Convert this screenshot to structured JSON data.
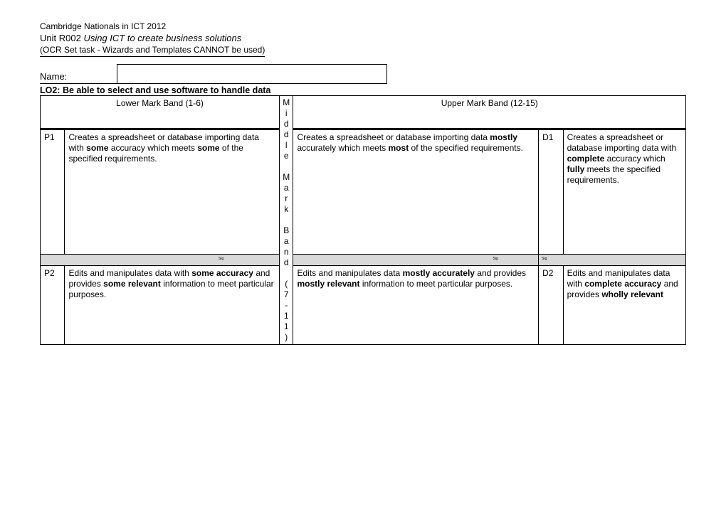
{
  "header": {
    "course": "Cambridge Nationals in ICT 2012",
    "unit": "Unit R002",
    "unit_title": "Using ICT to create business solutions",
    "note": "(OCR Set task - Wizards and Templates CANNOT be used)",
    "name_label": "Name:"
  },
  "lo": "LO2: Be able to select and use software to handle data",
  "bands": {
    "lower": "Lower Mark Band (1-6)",
    "upper": "Upper Mark Band (12-15)",
    "middle_vertical": "Middle Mark Band (7-11)"
  },
  "rows": [
    {
      "p": "P1",
      "lower_html": "Creates a spreadsheet or database importing data with <b>some</b> accuracy which meets <b>some</b> of the specified requirements.",
      "middle_html": "Creates a spreadsheet or database importing data <b>mostly</b> accurately which meets <b>most</b> of the specified requirements.",
      "d": "D1",
      "upper_html": "Creates a spreadsheet or database importing data with <b>complete</b> accuracy which <b>fully</b> meets the specified requirements."
    },
    {
      "p": "P2",
      "lower_html": "Edits and manipulates data with <b>some accuracy</b> and provides <b>some relevant</b> information to meet particular purposes.",
      "middle_html": "Edits and manipulates data <b>mostly accurately</b> and provides <b>mostly relevant</b> information to meet particular purposes.",
      "d": "D2",
      "upper_html": "Edits and manipulates data with <b>complete accuracy</b> and provides <b>wholly relevant</b>"
    }
  ],
  "sig": "Sig"
}
